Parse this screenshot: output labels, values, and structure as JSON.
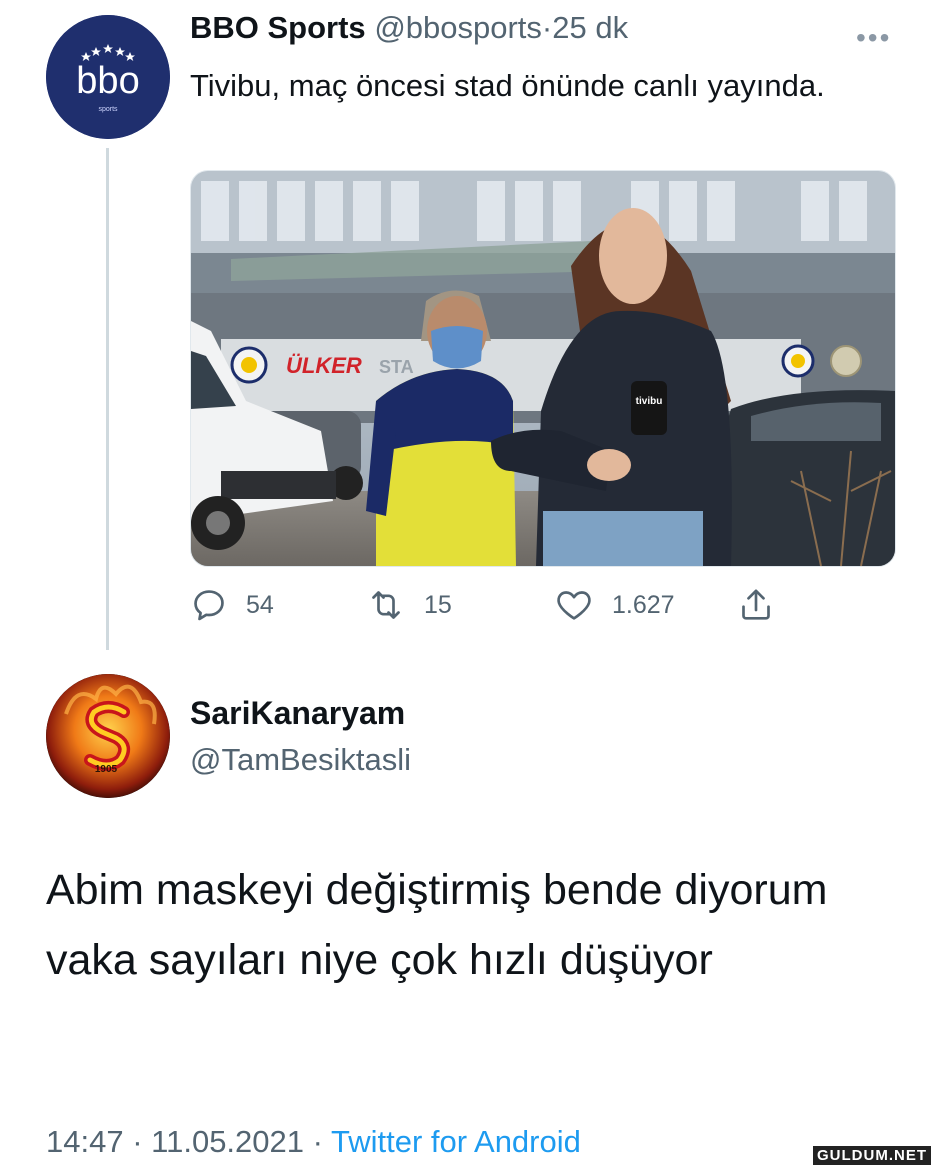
{
  "tweet": {
    "avatar_icon": "bbo-sports-logo",
    "avatar_text": "bbo",
    "avatar_subtext": "sports",
    "display_name": "BBO Sports",
    "handle": "@bbosports",
    "separator": "·",
    "time_ago": "25 dk",
    "more_icon": "more-dots-icon",
    "more_label": "•••",
    "text": "Tivibu, maç öncesi stad önünde canlı yayında.",
    "media": {
      "stadium_sign": "ÜLKER",
      "stadium_sign_rest": "STA",
      "mic_flag": "tivibu"
    },
    "actions": {
      "reply_icon": "reply-icon",
      "reply_count": "54",
      "retweet_icon": "retweet-icon",
      "retweet_count": "15",
      "like_icon": "heart-icon",
      "like_count": "1.627",
      "share_icon": "share-icon"
    }
  },
  "reply": {
    "avatar_icon": "galatasaray-logo",
    "avatar_year": "1905",
    "display_name": "SariKanaryam",
    "handle": "@TamBesiktasli",
    "text": "Abim maskeyi değiştirmiş bende diyorum vaka sayıları niye çok hızlı düşüyor",
    "time": "14:47",
    "separator": "·",
    "date": "11.05.2021",
    "source": "Twitter for Android"
  },
  "watermark": "GULDUM.NET",
  "colors": {
    "text": "#0f1419",
    "secondary": "#536471",
    "link": "#1d9bf0",
    "thread_line": "#cfd9de",
    "bbo_navy": "#1f2f6e"
  }
}
